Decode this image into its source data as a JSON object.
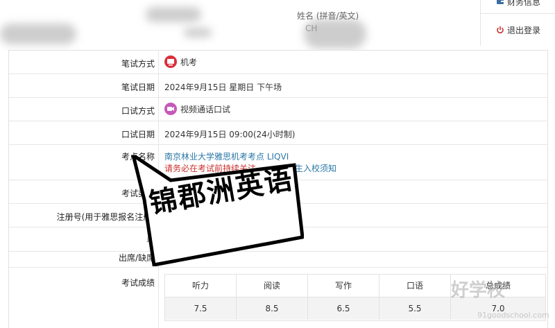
{
  "header": {
    "name_label": "姓名 (拼音/英文)",
    "sub_label": "CH"
  },
  "menu": {
    "finance": "财务信息",
    "logout": "退出登录"
  },
  "rows": [
    {
      "label": "笔试方式",
      "value": "机考"
    },
    {
      "label": "笔试日期",
      "value": "2024年9月15日 星期日  下午场"
    },
    {
      "label": "口试方式",
      "value": "视频通话口试"
    },
    {
      "label": "口试日期",
      "value": "2024年9月15日 09:00(24小时制)"
    },
    {
      "label": "考点名称",
      "value": "南京林业大学雅思机考考点  LIQVI",
      "warning": "请务必在考试前持续关注",
      "warning2": "考生入校须知"
    },
    {
      "label": "考试类型",
      "value": ""
    },
    {
      "label": "注册号(用于雅思报名注册)",
      "value": ""
    },
    {
      "label": "考",
      "value": ""
    },
    {
      "label": "出席/缺席",
      "value": "出席"
    },
    {
      "label": "考试成绩",
      "value": ""
    }
  ],
  "scores": {
    "headers": [
      "听力",
      "阅读",
      "写作",
      "口语",
      "总成绩"
    ],
    "values": [
      "7.5",
      "8.5",
      "6.5",
      "5.5",
      "7.0"
    ]
  },
  "overlay": {
    "bubble_text": "锦郡洲英语",
    "watermark": "好学校",
    "watermark_sub": "91goodschool.com"
  },
  "colors": {
    "link": "#2a78a8",
    "warning": "#c9302c",
    "logout_icon": "#c9302c"
  }
}
